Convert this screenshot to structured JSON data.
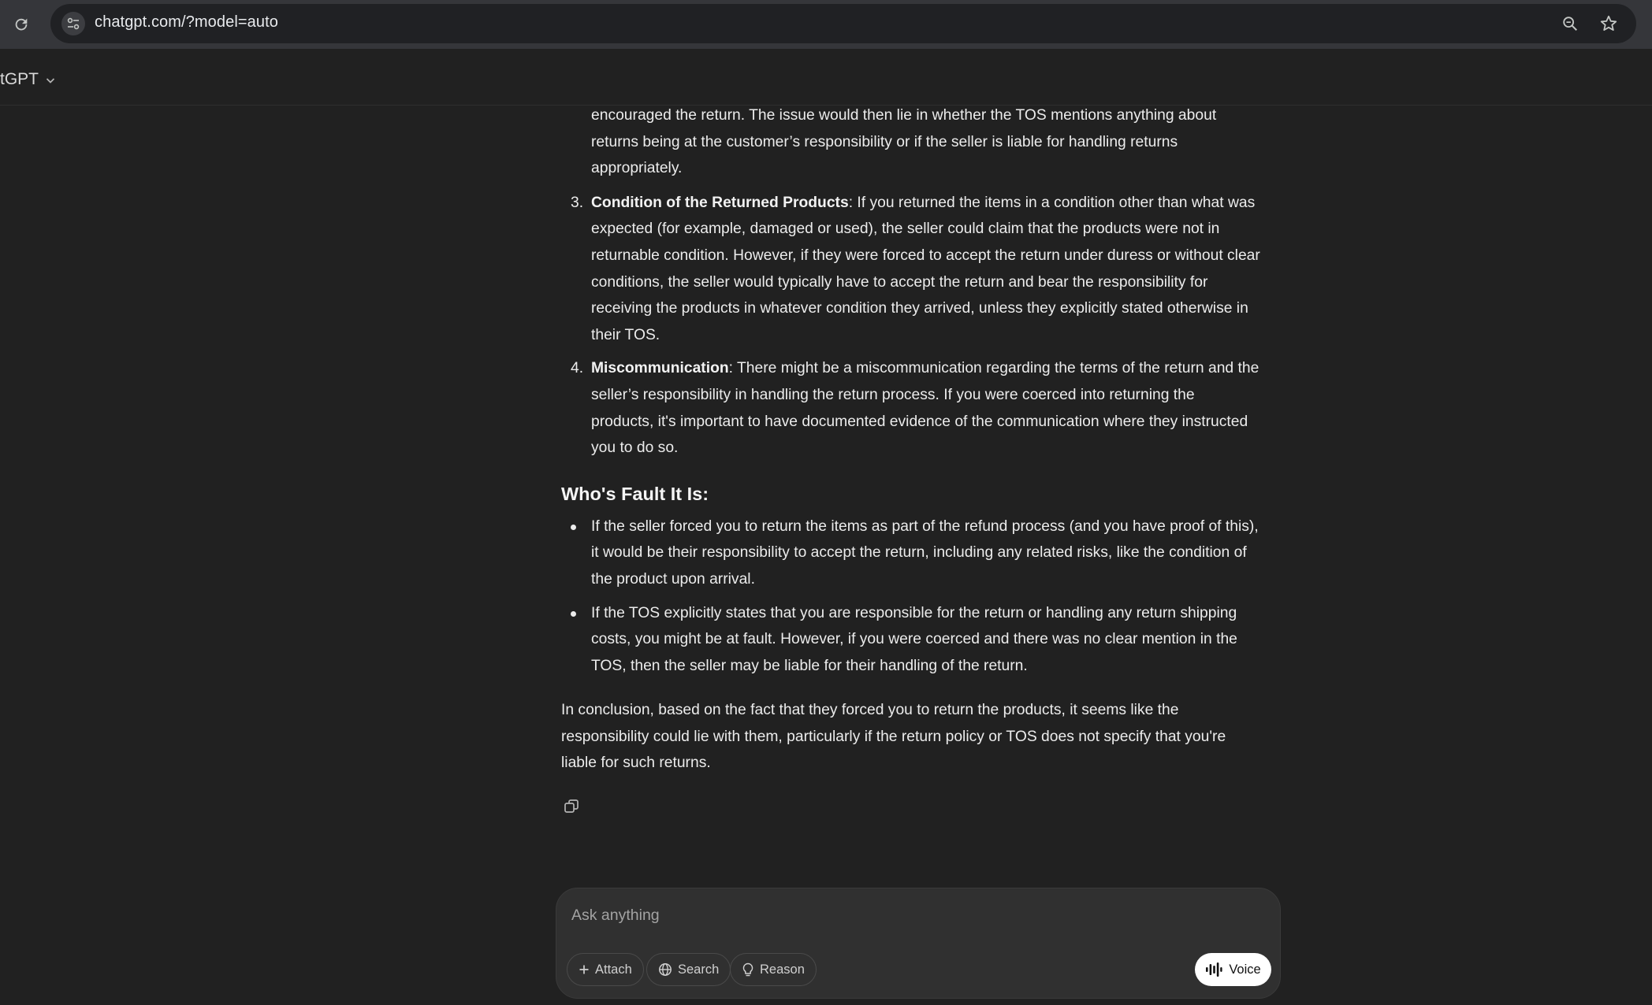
{
  "browser": {
    "url": "chatgpt.com/?model=auto"
  },
  "header": {
    "model_label": "tGPT"
  },
  "content": {
    "para_intro": "encouraged the return. The issue would then lie in whether the TOS mentions anything about returns being at the customer’s responsibility or if the seller is liable for handling returns appropriately.",
    "items": [
      {
        "number": "3.",
        "title": "Condition of the Returned Products",
        "body": ": If you returned the items in a condition other than what was expected (for example, damaged or used), the seller could claim that the products were not in returnable condition. However, if they were forced to accept the return under duress or without clear conditions, the seller would typically have to accept the return and bear the responsibility for receiving the products in whatever condition they arrived, unless they explicitly stated otherwise in their TOS."
      },
      {
        "number": "4.",
        "title": "Miscommunication",
        "body": ": There might be a miscommunication regarding the terms of the return and the seller’s responsibility in handling the return process. If you were coerced into returning the products, it's important to have documented evidence of the communication where they instructed you to do so."
      }
    ],
    "heading": "Who's Fault It Is:",
    "bullets": [
      "If the seller forced you to return the items as part of the refund process (and you have proof of this), it would be their responsibility to accept the return, including any related risks, like the condition of the product upon arrival.",
      "If the TOS explicitly states that you are responsible for the return or handling any return shipping costs, you might be at fault. However, if you were coerced and there was no clear mention in the TOS, then the seller may be liable for their handling of the return."
    ],
    "conclusion": "In conclusion, based on the fact that they forced you to return the products, it seems like the responsibility could lie with them, particularly if the return policy or TOS does not specify that you're liable for such returns."
  },
  "composer": {
    "placeholder": "Ask anything",
    "attach_label": "Attach",
    "search_label": "Search",
    "reason_label": "Reason",
    "voice_label": "Voice"
  },
  "icons": {
    "reload": "reload-icon",
    "site_info": "tune-icon",
    "zoom": "zoom-icon",
    "bookmark": "star-icon",
    "copy": "copy-icon",
    "plus": "plus-icon",
    "globe": "globe-icon",
    "bulb": "lightbulb-icon",
    "voice": "waveform-icon"
  }
}
